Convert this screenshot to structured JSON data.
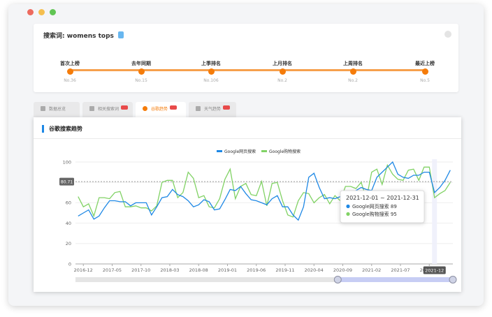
{
  "search": {
    "label": "搜索词:",
    "keyword": "womens tops"
  },
  "milestones": [
    {
      "label": "首次上榜",
      "value": "No.36"
    },
    {
      "label": "去年同期",
      "value": "No.15"
    },
    {
      "label": "上季排名",
      "value": "No.106"
    },
    {
      "label": "上月排名",
      "value": "No.2"
    },
    {
      "label": "上周排名",
      "value": "No.2"
    },
    {
      "label": "最近上榜",
      "value": "No.5"
    }
  ],
  "tabs": [
    {
      "label": "数据总览",
      "badge": false,
      "active": false
    },
    {
      "label": "相关搜索词",
      "badge": true,
      "active": false
    },
    {
      "label": "谷歌趋势",
      "badge": true,
      "active": true
    },
    {
      "label": "天气趋势",
      "badge": true,
      "active": false
    }
  ],
  "chart_title": "谷歌搜索趋势",
  "colors": {
    "accent": "#f57c0a",
    "web": "#1e88e5",
    "shopping": "#81d265"
  },
  "chart_data": {
    "type": "line",
    "series": [
      {
        "name": "Google网页搜索",
        "color": "#1e88e5",
        "values": [
          47,
          50,
          53,
          44,
          47,
          55,
          62,
          62,
          61,
          61,
          57,
          60,
          60,
          60,
          48,
          56,
          65,
          66,
          73,
          68,
          66,
          62,
          56,
          58,
          63,
          61,
          53,
          54,
          63,
          73,
          72,
          76,
          69,
          63,
          62,
          60,
          58,
          64,
          67,
          56,
          56,
          48,
          43,
          56,
          85,
          89,
          75,
          64,
          65,
          64,
          66,
          68,
          70,
          72,
          75,
          73,
          72,
          85,
          90,
          95,
          100,
          88,
          85,
          84,
          87,
          87,
          90,
          90,
          70,
          75,
          82,
          92
        ]
      },
      {
        "name": "Google购物搜索",
        "color": "#81d265",
        "values": [
          66,
          56,
          59,
          47,
          65,
          65,
          64,
          70,
          71,
          56,
          56,
          57,
          55,
          55,
          52,
          57,
          80,
          82,
          82,
          65,
          70,
          90,
          84,
          65,
          67,
          56,
          55,
          64,
          83,
          93,
          64,
          76,
          79,
          68,
          67,
          81,
          57,
          79,
          80,
          62,
          48,
          46,
          62,
          70,
          69,
          60,
          65,
          68,
          59,
          67,
          62,
          76,
          76,
          74,
          80,
          64,
          90,
          93,
          78,
          97,
          88,
          83,
          82,
          92,
          93,
          82,
          95,
          95,
          65,
          69,
          72,
          80
        ]
      }
    ],
    "x_tick_labels": [
      "2016-12",
      "2017-05",
      "2017-10",
      "2018-03",
      "2018-08",
      "2019-01",
      "2019-06",
      "2019-11",
      "2020-04",
      "2020-09",
      "2021-02",
      "2021-07",
      "2021-12"
    ],
    "y_ticks": [
      0,
      20,
      40,
      60,
      80,
      100
    ],
    "ylim": [
      0,
      100
    ],
    "reference_line": {
      "value": 80.71,
      "label": "80.71"
    },
    "tooltip": {
      "title": "2021-12-01 ~ 2021-12-31",
      "items": [
        {
          "name": "Google网页搜索",
          "value": "89"
        },
        {
          "name": "Google购物搜索",
          "value": "95"
        }
      ]
    },
    "axis_pointer_label": "2021-12",
    "legend_position": "top-center",
    "grid": true,
    "zoom_range": [
      0.695,
      1.0
    ]
  }
}
